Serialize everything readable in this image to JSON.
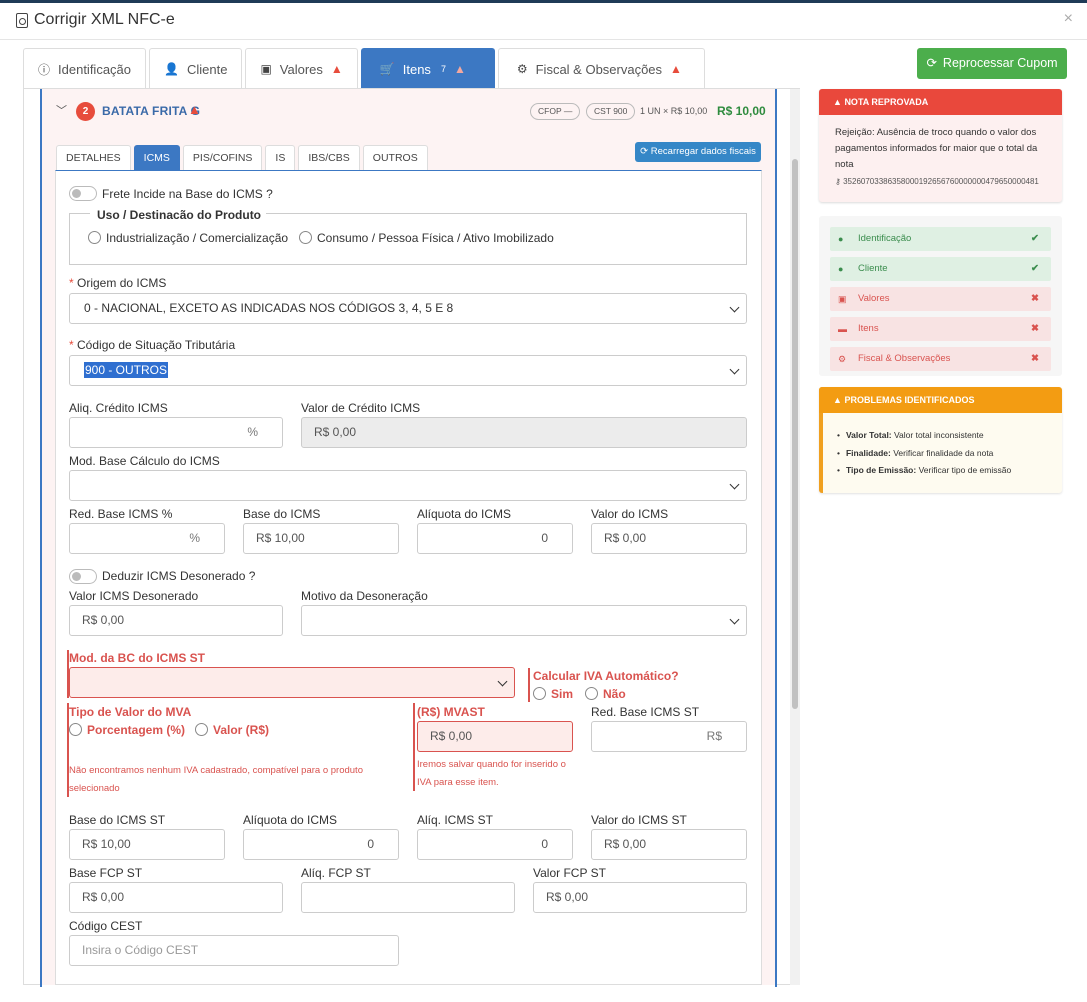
{
  "window": {
    "title": "Corrigir XML NFC-e"
  },
  "tabs": [
    {
      "label": "Identificação",
      "icon": "info-icon"
    },
    {
      "label": "Cliente",
      "icon": "user-icon"
    },
    {
      "label": "Valores",
      "icon": "money-icon"
    },
    {
      "label": "Itens",
      "icon": "cart-icon",
      "count": "7"
    },
    {
      "label": "Fiscal & Observações",
      "icon": "gears-icon"
    }
  ],
  "item": {
    "number": "2",
    "name": "BATATA FRITA G",
    "cfop": "CFOP —",
    "cst": "CST 900",
    "qty": "1 UN × R$ 10,00",
    "total": "R$ 10,00"
  },
  "subtabs": [
    "DETALHES",
    "ICMS",
    "PIS/COFINS",
    "IS",
    "IBS/CBS",
    "OUTROS"
  ],
  "reload_label": "Recarregar dados fiscais",
  "form": {
    "frete_label": "Frete Incide na Base do ICMS ?",
    "uso_legend": "Uso / Destinacão do Produto",
    "uso_opt1": "Industrialização / Comercialização",
    "uso_opt2": "Consumo / Pessoa Física / Ativo Imobilizado",
    "origem_label": "Origem do ICMS",
    "origem_value": "0 - NACIONAL, EXCETO AS INDICADAS NOS CÓDIGOS 3, 4, 5 E 8",
    "cst_label": "Código de Situação Tributária",
    "cst_value": "900 - OUTROS",
    "aliq_credito_label": "Aliq. Crédito ICMS",
    "pct": "%",
    "valor_credito_label": "Valor de Crédito ICMS",
    "valor_credito_value": "R$ 0,00",
    "mod_base_label": "Mod. Base Cálculo do ICMS",
    "red_base_label": "Red. Base ICMS %",
    "base_icms_label": "Base do ICMS",
    "base_icms_value": "R$ 10,00",
    "aliq_icms_label": "Alíquota do ICMS",
    "aliq_icms_value": "0",
    "valor_icms_label": "Valor do ICMS",
    "valor_icms_value": "R$ 0,00",
    "deduzir_label": "Deduzir ICMS Desonerado ?",
    "valor_deson_label": "Valor ICMS Desonerado",
    "valor_deson_value": "R$ 0,00",
    "motivo_label": "Motivo da Desoneração",
    "mod_bc_st_label": "Mod. da BC do ICMS ST",
    "calc_iva_label": "Calcular IVA Automático?",
    "sim": "Sim",
    "nao": "Não",
    "tipo_mva_label": "Tipo de Valor do MVA",
    "porcentagem": "Porcentagem (%)",
    "valor_rs": "Valor (R$)",
    "mva_err": "Não encontramos nenhum IVA cadastrado, compatível para o produto selecionado",
    "mvast_label": "(R$) MVAST",
    "mvast_value": "R$ 0,00",
    "mvast_err": "Iremos salvar quando for inserido o IVA para esse item.",
    "red_base_st_label": "Red. Base ICMS ST",
    "rs": "R$",
    "base_st_label": "Base do ICMS ST",
    "base_st_value": "R$ 10,00",
    "aliq_icms2_label": "Alíquota do ICMS",
    "aliq_icms2_value": "0",
    "aliq_st_label": "Alíq. ICMS ST",
    "aliq_st_value": "0",
    "valor_st_label": "Valor do ICMS ST",
    "valor_st_value": "R$ 0,00",
    "base_fcp_label": "Base FCP ST",
    "base_fcp_value": "R$ 0,00",
    "aliq_fcp_label": "Alíq. FCP ST",
    "valor_fcp_label": "Valor FCP ST",
    "valor_fcp_value": "R$ 0,00",
    "cest_label": "Código CEST",
    "cest_placeholder": "Insira o Código CEST"
  },
  "reprocess_label": "Reprocessar Cupom",
  "nota": {
    "title": "NOTA REPROVADA",
    "message": "Rejeição: Ausência de troco quando o valor dos pagamentos informados for maior que o total da nota",
    "key": "35260703386358000192656760000000479650000481"
  },
  "checklist": [
    {
      "label": "Identificação",
      "status": "ok"
    },
    {
      "label": "Cliente",
      "status": "ok"
    },
    {
      "label": "Valores",
      "status": "bad"
    },
    {
      "label": "Itens",
      "status": "bad"
    },
    {
      "label": "Fiscal & Observações",
      "status": "bad"
    }
  ],
  "problems": {
    "title": "PROBLEMAS IDENTIFICADOS",
    "items": [
      {
        "k": "Valor Total:",
        "v": "Valor total inconsistente"
      },
      {
        "k": "Finalidade:",
        "v": "Verificar finalidade da nota"
      },
      {
        "k": "Tipo de Emissão:",
        "v": "Verificar tipo de emissão"
      }
    ]
  },
  "colors": {
    "primary": "#3c78c3",
    "danger": "#e9483c",
    "success": "#4cae4c",
    "warning": "#f39c12"
  }
}
